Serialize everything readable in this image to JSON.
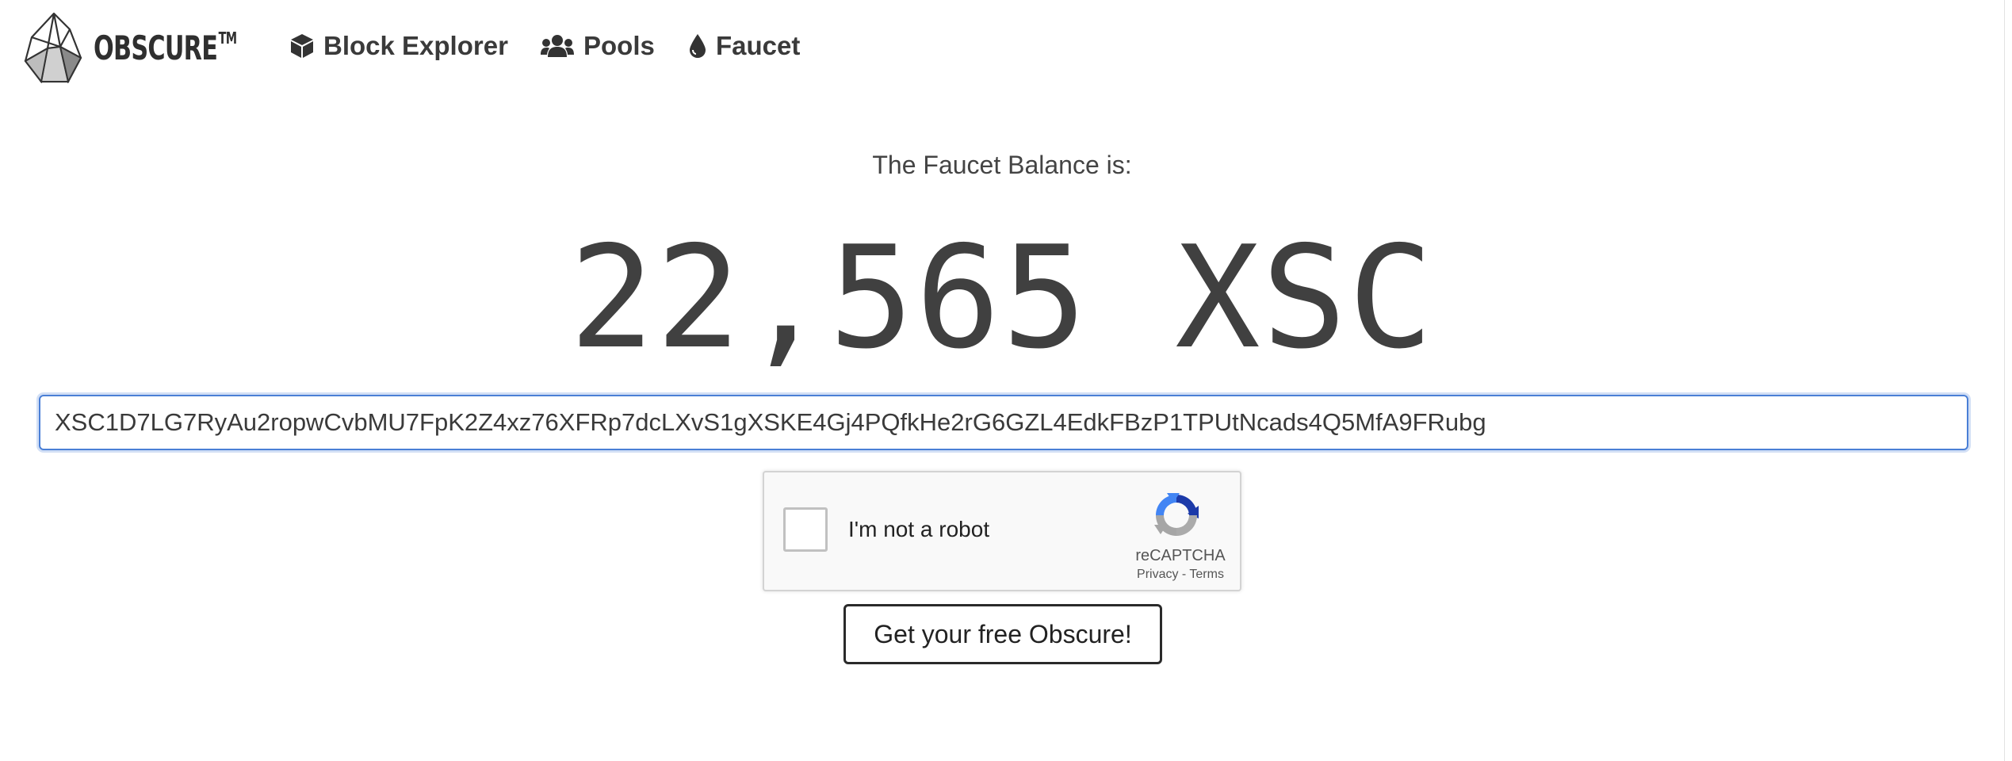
{
  "brand": {
    "name": "OBSCURE",
    "trademark": "TM"
  },
  "nav": {
    "items": [
      {
        "label": "Block Explorer",
        "icon": "cube-icon"
      },
      {
        "label": "Pools",
        "icon": "users-icon"
      },
      {
        "label": "Faucet",
        "icon": "droplet-icon"
      }
    ]
  },
  "faucet": {
    "balance_label": "The Faucet Balance is:",
    "balance_value": "22,565 XSC",
    "address_value": "XSC1D7LG7RyAu2ropwCvbMU7FpK2Z4xz76XFRp7dcLXvS1gXSKE4Gj4PQfkHe2rG6GZL4EdkFBzP1TPUtNcads4Q5MfA9FRubg"
  },
  "recaptcha": {
    "label": "I'm not a robot",
    "brand": "reCAPTCHA",
    "privacy": "Privacy",
    "separator": " - ",
    "terms": "Terms"
  },
  "submit": {
    "label": "Get your free Obscure!"
  },
  "colors": {
    "input_focus_border": "#4a7fd6",
    "text": "#333333",
    "recaptcha_blue": "#1c3aa9",
    "recaptcha_gray": "#a6a6a6"
  }
}
